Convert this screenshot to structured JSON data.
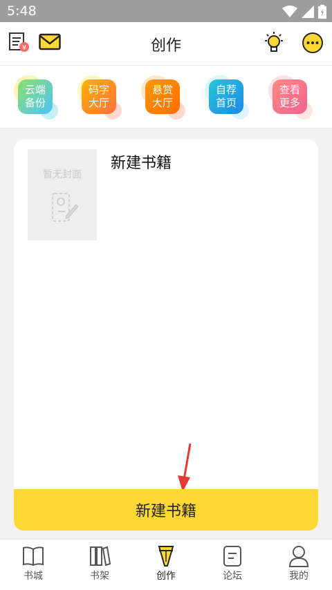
{
  "status": {
    "time": "5:48"
  },
  "header": {
    "title": "创作"
  },
  "quick_actions": [
    {
      "line1": "云端",
      "line2": "备份",
      "color": "#7ed957"
    },
    {
      "line1": "码字",
      "line2": "大厅",
      "color": "#ff8a33"
    },
    {
      "line1": "悬赏",
      "line2": "大厅",
      "color": "#ff7a2e"
    },
    {
      "line1": "自荐",
      "line2": "首页",
      "color": "#29b6f6"
    },
    {
      "line1": "查看",
      "line2": "更多",
      "color": "#ff5c7a"
    }
  ],
  "book": {
    "cover_placeholder": "暂无封面",
    "title": "新建书籍"
  },
  "new_button": {
    "label": "新建书籍"
  },
  "tabs": [
    {
      "label": "书城"
    },
    {
      "label": "书架"
    },
    {
      "label": "创作"
    },
    {
      "label": "论坛"
    },
    {
      "label": "我的"
    }
  ],
  "colors": {
    "accent": "#fdd835",
    "arrow": "#e53935"
  }
}
